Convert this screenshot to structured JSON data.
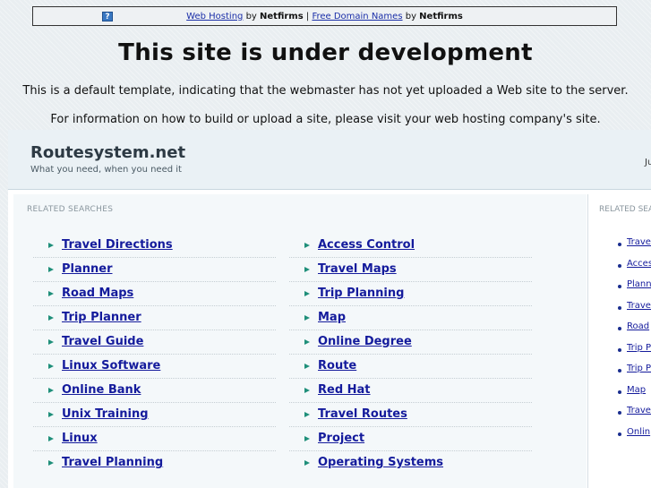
{
  "banner": {
    "web_hosting": "Web Hosting",
    "by1": "by",
    "netfirms1": "Netfirms",
    "sep": "|",
    "free_domain": "Free Domain Names",
    "by2": "by",
    "netfirms2": "Netfirms",
    "icon": "question-icon"
  },
  "heading": "This site is under development",
  "notes": [
    "This is a default template, indicating that the webmaster has not yet uploaded a Web site to the server.",
    "For information on how to build or upload a site, please visit your web hosting company's site."
  ],
  "site": {
    "title": "Routesystem.net",
    "tagline": "What you need, when you need it",
    "header_right_fragment": "Ju"
  },
  "related_heading": "RELATED SEARCHES",
  "col1": [
    "Travel Directions",
    "Planner",
    "Road Maps",
    "Trip Planner",
    "Travel Guide",
    "Linux Software",
    "Online Bank",
    "Unix Training",
    "Linux",
    "Travel Planning"
  ],
  "col2": [
    "Access Control",
    "Travel Maps",
    "Trip Planning",
    "Map",
    "Online Degree",
    "Route",
    "Red Hat",
    "Travel Routes",
    "Project",
    "Operating Systems"
  ],
  "side": {
    "heading": "RELATED SEA",
    "items": [
      "Travel",
      "Access",
      "Plann",
      "Travel",
      "Road",
      "Trip P",
      "Trip P",
      "Map",
      "Travel",
      "Onlin"
    ]
  }
}
